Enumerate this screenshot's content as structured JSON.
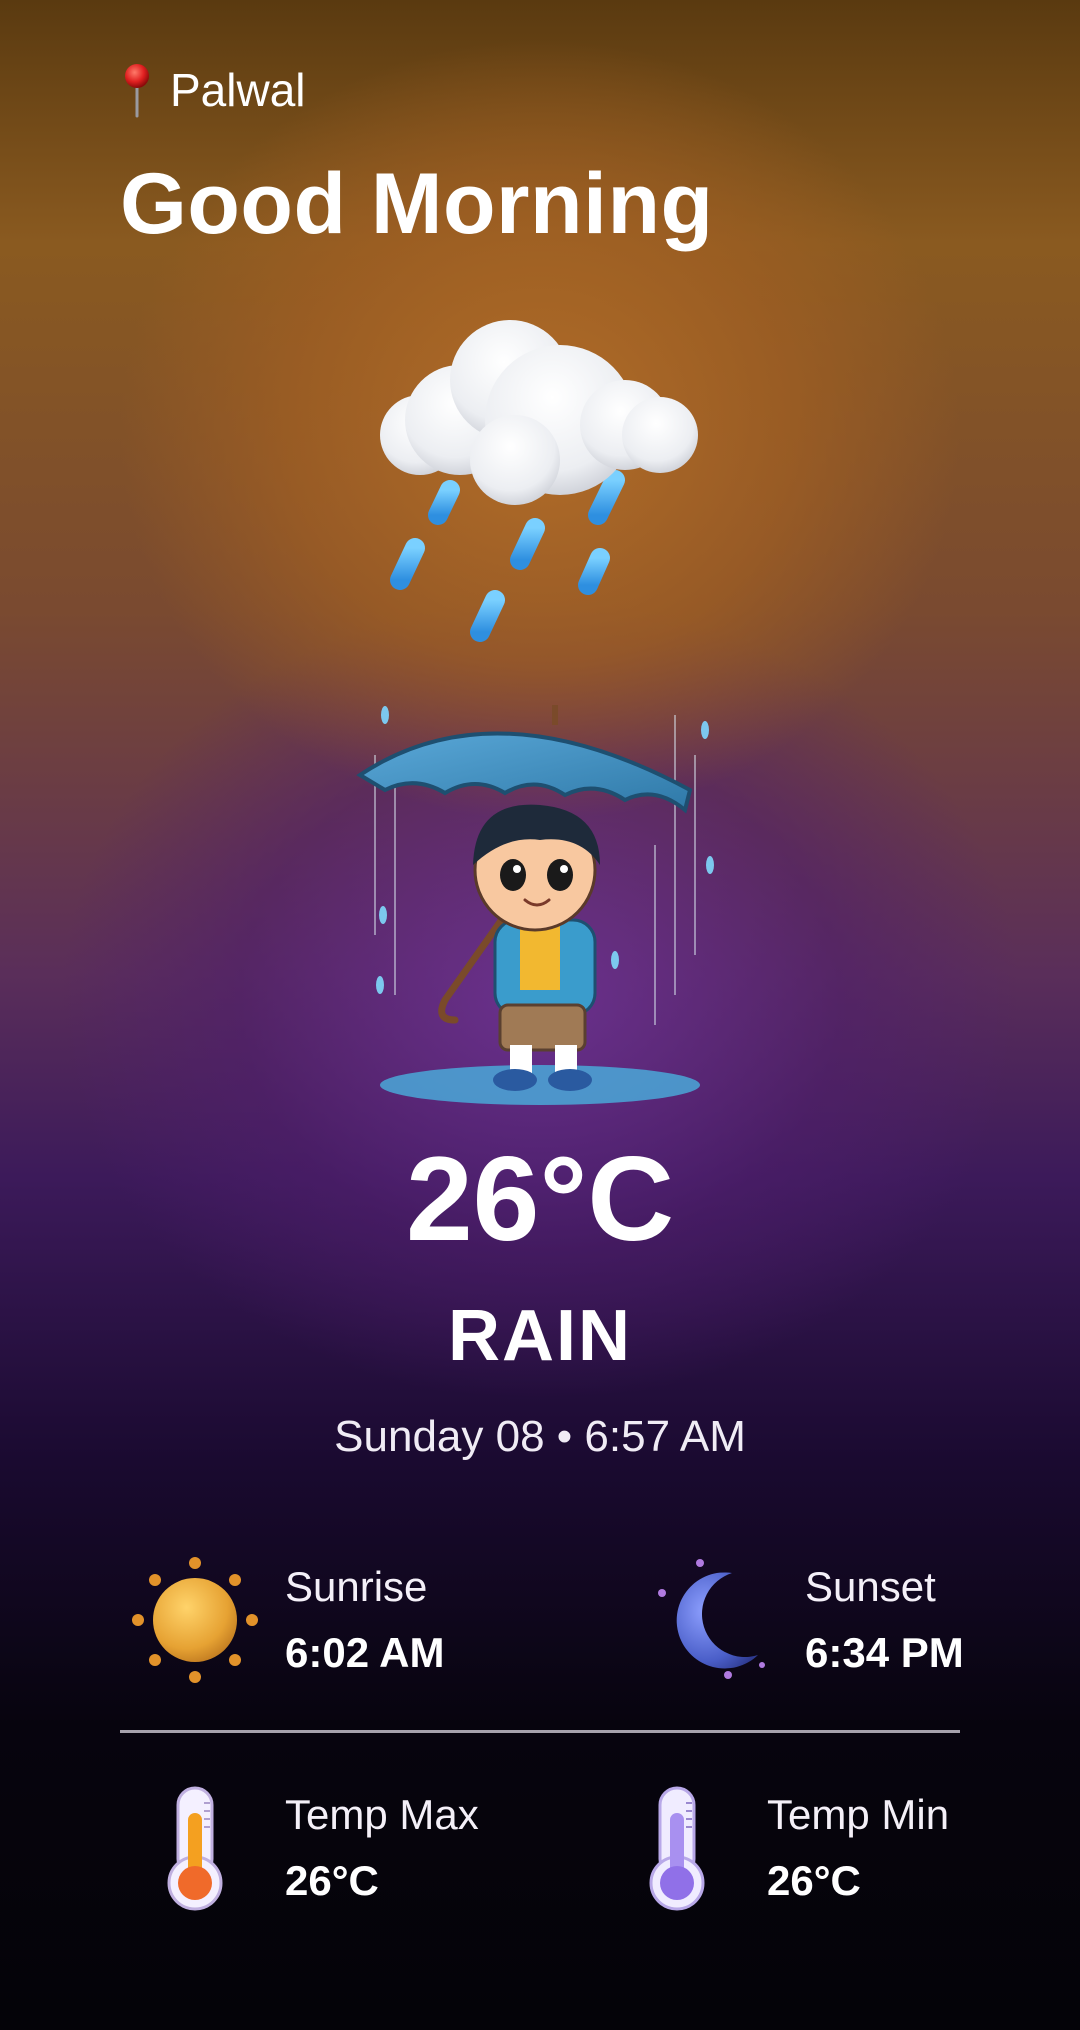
{
  "location": {
    "name": "Palwal",
    "icon": "map-pin-icon"
  },
  "greeting": "Good Morning",
  "weather": {
    "icon": "rain-cloud-icon",
    "illustration": "boy-with-umbrella-illustration",
    "temperature": "26°C",
    "condition": "RAIN",
    "datetime": "Sunday 08 • 6:57 AM"
  },
  "stats": {
    "sunrise": {
      "label": "Sunrise",
      "value": "6:02 AM",
      "icon": "sun-icon"
    },
    "sunset": {
      "label": "Sunset",
      "value": "6:34 PM",
      "icon": "moon-icon"
    },
    "temp_max": {
      "label": "Temp Max",
      "value": "26°C",
      "icon": "thermometer-hot-icon"
    },
    "temp_min": {
      "label": "Temp Min",
      "value": "26°C",
      "icon": "thermometer-cold-icon"
    }
  },
  "colors": {
    "accent_warm": "#b06e28",
    "accent_purple": "#4a2270",
    "background_dark": "#050308",
    "text": "#ffffff"
  }
}
